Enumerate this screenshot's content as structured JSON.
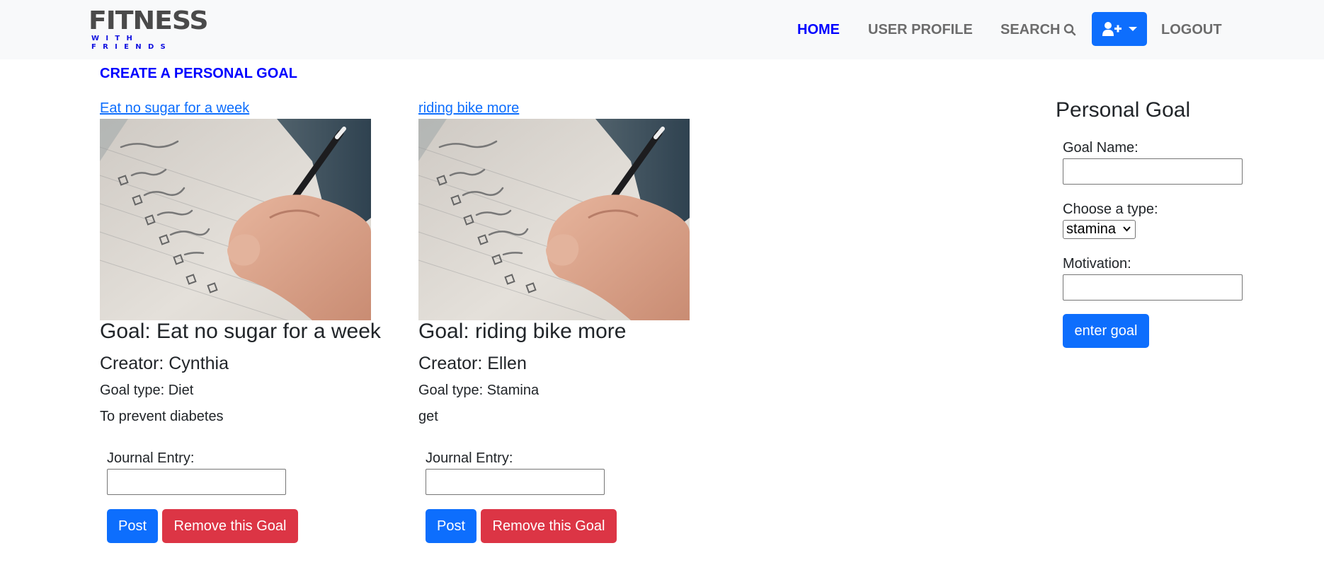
{
  "brand": {
    "name": "FITNESS",
    "tagline": "WITH FRIENDS"
  },
  "nav": {
    "home": "HOME",
    "profile": "USER PROFILE",
    "search": "SEARCH",
    "logout": "LOGOUT"
  },
  "create_link": "CREATE A PERSONAL GOAL",
  "goals": [
    {
      "link": "Eat no sugar for a week",
      "heading": "Goal: Eat no sugar for a week",
      "creator": "Creator: Cynthia",
      "type": "Goal type: Diet",
      "motivation": "To prevent diabetes",
      "journal_label": "Journal Entry:",
      "journal_value": "",
      "post_label": "Post",
      "remove_label": "Remove this Goal"
    },
    {
      "link": "riding bike more",
      "heading": "Goal: riding bike more",
      "creator": "Creator: Ellen",
      "type": "Goal type: Stamina",
      "motivation": "get",
      "journal_label": "Journal Entry:",
      "journal_value": "",
      "post_label": "Post",
      "remove_label": "Remove this Goal"
    }
  ],
  "form": {
    "title": "Personal Goal",
    "name_label": "Goal Name:",
    "name_value": "",
    "type_label": "Choose a type:",
    "type_selected": "stamina",
    "motivation_label": "Motivation:",
    "motivation_value": "",
    "submit_label": "enter goal"
  },
  "colors": {
    "primary": "#0d6efd",
    "danger": "#dc3545",
    "nav_active": "#0000ff",
    "nav_bg": "#f8f9fa"
  }
}
